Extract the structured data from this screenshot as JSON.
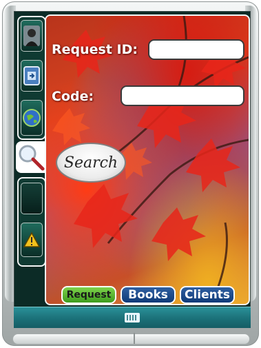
{
  "form": {
    "request_id_label": "Request ID:",
    "request_id_value": "",
    "code_label": "Code:",
    "code_value": "",
    "search_label": "Search"
  },
  "tabs": [
    {
      "label": "Request",
      "active": true
    },
    {
      "label": "Books",
      "active": false
    },
    {
      "label": "Clients",
      "active": false
    }
  ],
  "sidebar": {
    "items": [
      {
        "icon": "user-icon"
      },
      {
        "icon": "window-icon"
      },
      {
        "icon": "globe-icon"
      },
      {
        "icon": "search-icon",
        "active": true
      },
      {
        "icon": "blank-icon"
      },
      {
        "icon": "warning-icon"
      }
    ]
  },
  "command_bar": {
    "icon": "keyboard-icon"
  },
  "colors": {
    "tab_active": "#5fb833",
    "tab_inactive": "#1a4a8a",
    "command_bar": "#1f7c84"
  }
}
